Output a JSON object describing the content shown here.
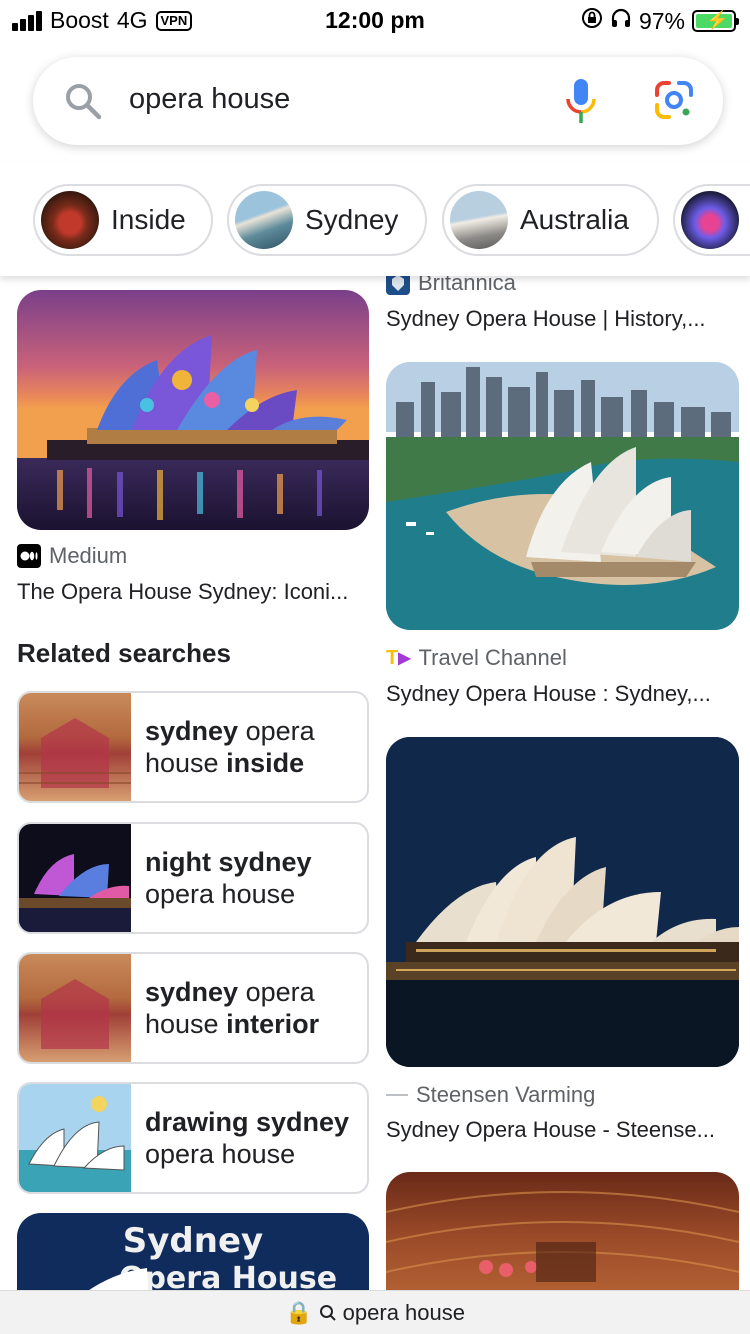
{
  "status_bar": {
    "carrier": "Boost",
    "network": "4G",
    "vpn": "VPN",
    "time": "12:00 pm",
    "battery": "97%"
  },
  "search": {
    "query": "opera house"
  },
  "chips": [
    {
      "label": "Inside"
    },
    {
      "label": "Sydney"
    },
    {
      "label": "Australia"
    },
    {
      "label": ""
    }
  ],
  "results_left": [
    {
      "source": "Medium",
      "title": "The Opera House Sydney: Iconi..."
    }
  ],
  "results_right": [
    {
      "source": "Britannica",
      "title": "Sydney Opera House | History,..."
    },
    {
      "source": "Travel Channel",
      "title": "Sydney Opera House : Sydney,..."
    },
    {
      "source": "Steensen Varming",
      "title": "Sydney Opera House - Steense..."
    }
  ],
  "related": {
    "heading": "Related searches",
    "items": [
      {
        "bold1": "sydney",
        "norm1": " opera",
        "norm2": "house ",
        "bold2": "inside"
      },
      {
        "bold1": "night sydney",
        "norm1": "",
        "norm2": "opera house",
        "bold2": ""
      },
      {
        "bold1": "sydney",
        "norm1": " opera",
        "norm2": "house ",
        "bold2": "interior"
      },
      {
        "bold1": "drawing sydney",
        "norm1": "",
        "norm2": "opera house",
        "bold2": ""
      }
    ]
  },
  "promo_image_text": {
    "line1": "Sydney",
    "line2": "Opera House"
  },
  "bottom_bar": {
    "url": "opera house"
  },
  "colors": {
    "accent_blue": "#4285f4",
    "accent_red": "#ea4335",
    "accent_yellow": "#fbbc05",
    "accent_green": "#34a853",
    "chip_border": "#dadce0"
  }
}
